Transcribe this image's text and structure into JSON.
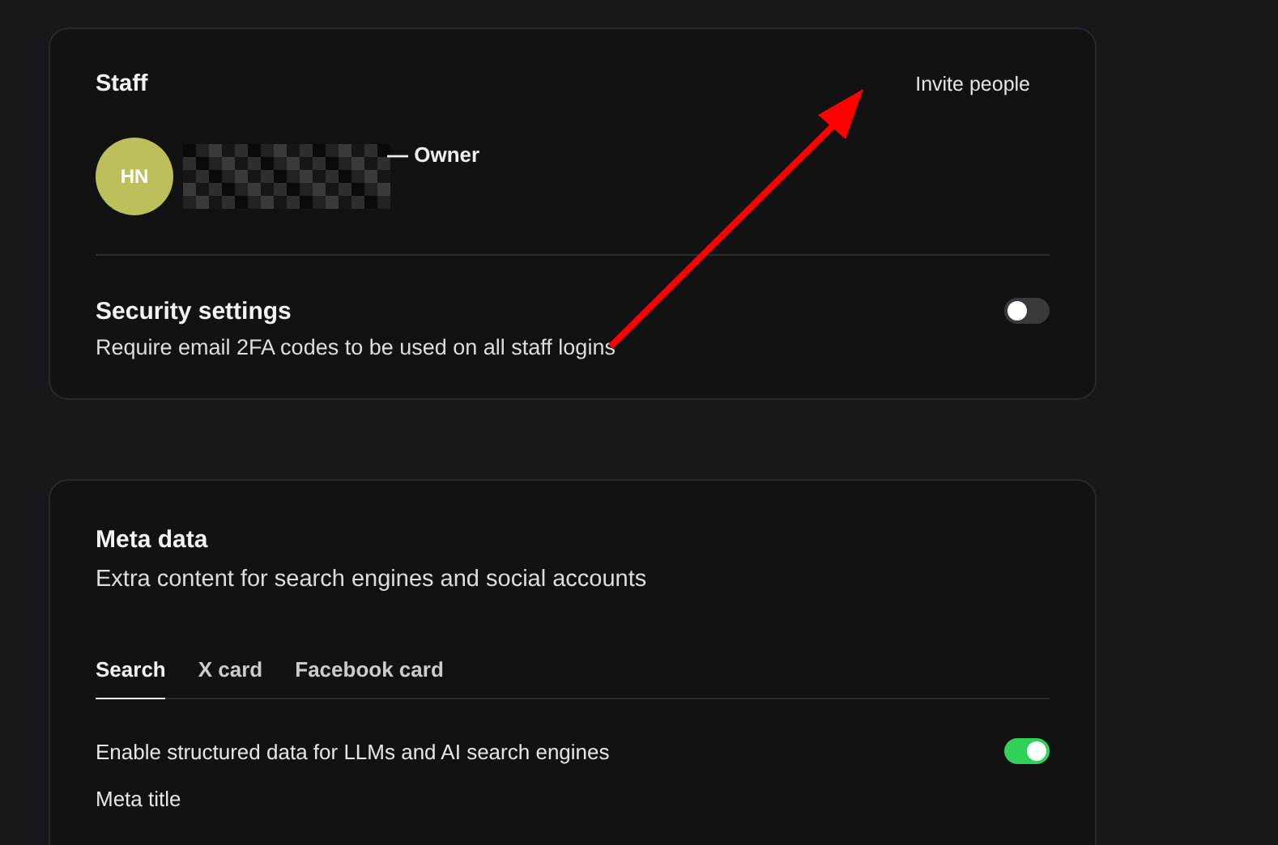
{
  "staff": {
    "title": "Staff",
    "invite": "Invite people",
    "members": [
      {
        "initials": "HN",
        "role": "— Owner"
      }
    ]
  },
  "security": {
    "title": "Security settings",
    "description": "Require email 2FA codes to be used on all staff logins",
    "on": false
  },
  "meta": {
    "title": "Meta data",
    "description": "Extra content for search engines and social accounts",
    "tabs": [
      {
        "label": "Search",
        "selected": true
      },
      {
        "label": "X card",
        "selected": false
      },
      {
        "label": "Facebook card",
        "selected": false
      }
    ],
    "structured_data": {
      "label": "Enable structured data for LLMs and AI search engines",
      "on": true
    },
    "field_label": "Meta title"
  }
}
